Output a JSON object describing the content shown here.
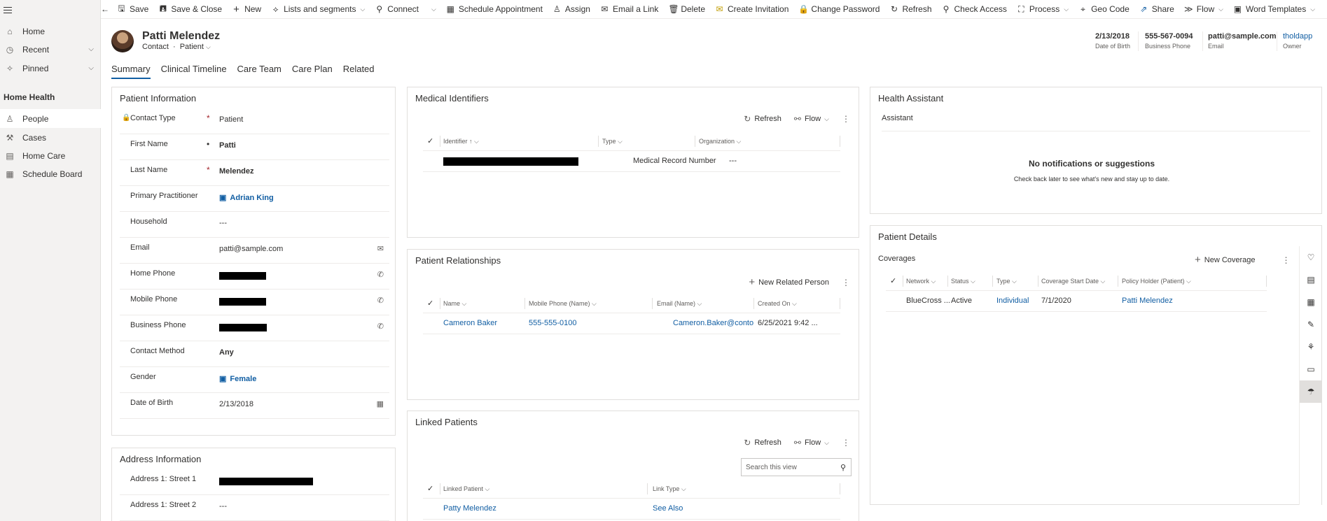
{
  "nav": {
    "items": [
      {
        "label": "Home",
        "icon": "home-icon"
      },
      {
        "label": "Recent",
        "icon": "clock-icon"
      },
      {
        "label": "Pinned",
        "icon": "pin-icon"
      }
    ],
    "section_title": "Home Health",
    "area_items": [
      {
        "label": "People",
        "icon": "person-icon"
      },
      {
        "label": "Cases",
        "icon": "wrench-icon"
      },
      {
        "label": "Home Care",
        "icon": "document-icon"
      },
      {
        "label": "Schedule Board",
        "icon": "calendar-icon"
      }
    ]
  },
  "commandbar": {
    "items": [
      {
        "label": "Save",
        "icon": "save-icon"
      },
      {
        "label": "Save & Close",
        "icon": "save-close-icon"
      },
      {
        "label": "New",
        "icon": "plus-icon"
      },
      {
        "label": "Lists and segments",
        "icon": "list-icon"
      },
      {
        "label": "Connect",
        "icon": "connect-icon"
      },
      {
        "label": "Schedule Appointment",
        "icon": "calendar-icon"
      },
      {
        "label": "Assign",
        "icon": "assign-icon"
      },
      {
        "label": "Email a Link",
        "icon": "email-icon"
      },
      {
        "label": "Delete",
        "icon": "delete-icon"
      },
      {
        "label": "Create Invitation",
        "icon": "invitation-icon"
      },
      {
        "label": "Change Password",
        "icon": "lock-icon"
      },
      {
        "label": "Refresh",
        "icon": "refresh-icon"
      },
      {
        "label": "Check Access",
        "icon": "check-access-icon"
      },
      {
        "label": "Process",
        "icon": "process-icon"
      },
      {
        "label": "Geo Code",
        "icon": "geo-icon"
      },
      {
        "label": "Share",
        "icon": "share-icon"
      },
      {
        "label": "Flow",
        "icon": "flow-icon"
      },
      {
        "label": "Word Templates",
        "icon": "word-icon"
      }
    ]
  },
  "record": {
    "name": "Patti Melendez",
    "entity": "Contact",
    "form": "Patient",
    "separator": "·",
    "header": [
      {
        "value": "2/13/2018",
        "label": "Date of Birth"
      },
      {
        "value": "555-567-0094",
        "label": "Business Phone"
      },
      {
        "value": "patti@sample.com",
        "label": "Email"
      },
      {
        "value": "tholdapp",
        "label": "Owner"
      }
    ]
  },
  "tabs": [
    "Summary",
    "Clinical Timeline",
    "Care Team",
    "Care Plan",
    "Related"
  ],
  "patient_info": {
    "title": "Patient Information",
    "fields": [
      {
        "label": "Contact Type",
        "value": "Patient",
        "required": "*"
      },
      {
        "label": "First Name",
        "value": "Patti",
        "required": "•"
      },
      {
        "label": "Last Name",
        "value": "Melendez",
        "required": "*"
      },
      {
        "label": "Primary Practitioner",
        "value": "Adrian King"
      },
      {
        "label": "Household",
        "value": "---"
      },
      {
        "label": "Email",
        "value": "patti@sample.com"
      },
      {
        "label": "Home Phone",
        "value": ""
      },
      {
        "label": "Mobile Phone",
        "value": ""
      },
      {
        "label": "Business Phone",
        "value": ""
      },
      {
        "label": "Contact Method",
        "value": "Any"
      },
      {
        "label": "Gender",
        "value": "Female"
      },
      {
        "label": "Date of Birth",
        "value": "2/13/2018"
      }
    ]
  },
  "address_info": {
    "title": "Address Information",
    "fields": [
      {
        "label": "Address 1: Street 1",
        "value": ""
      },
      {
        "label": "Address 1: Street 2",
        "value": "---"
      }
    ]
  },
  "medical_identifiers": {
    "title": "Medical Identifiers",
    "toolbar": {
      "refresh": "Refresh",
      "flow": "Flow"
    },
    "columns": [
      "Identifier",
      "Type",
      "Organization"
    ],
    "rows": [
      {
        "identifier": "",
        "type": "Medical Record Number",
        "organization": "---"
      }
    ]
  },
  "relationships": {
    "title": "Patient Relationships",
    "toolbar": {
      "new": "New Related Person"
    },
    "columns": [
      "Name",
      "Mobile Phone (Name)",
      "Email (Name)",
      "Created On"
    ],
    "rows": [
      {
        "name": "Cameron Baker",
        "mobile": "555-555-0100",
        "email": "Cameron.Baker@contoso.com",
        "created": "6/25/2021 9:42 ..."
      }
    ]
  },
  "linked_patients": {
    "title": "Linked Patients",
    "toolbar": {
      "refresh": "Refresh",
      "flow": "Flow"
    },
    "search_placeholder": "Search this view",
    "columns": [
      "Linked Patient",
      "Link Type"
    ],
    "rows": [
      {
        "patient": "Patty Melendez",
        "link_type": "See Also"
      }
    ]
  },
  "health_assistant": {
    "title": "Health Assistant",
    "subtitle": "Assistant",
    "empty_title": "No notifications or suggestions",
    "empty_text": "Check back later to see what's new and stay up to date."
  },
  "patient_details": {
    "title": "Patient Details",
    "coverages": "Coverages",
    "new_coverage": "New Coverage",
    "columns": [
      "Network",
      "Status",
      "Type",
      "Coverage Start Date",
      "Policy Holder (Patient)"
    ],
    "rows": [
      {
        "network": "BlueCross ...",
        "status": "Active",
        "type": "Individual",
        "start": "7/1/2020",
        "holder": "Patti Melendez"
      }
    ]
  }
}
